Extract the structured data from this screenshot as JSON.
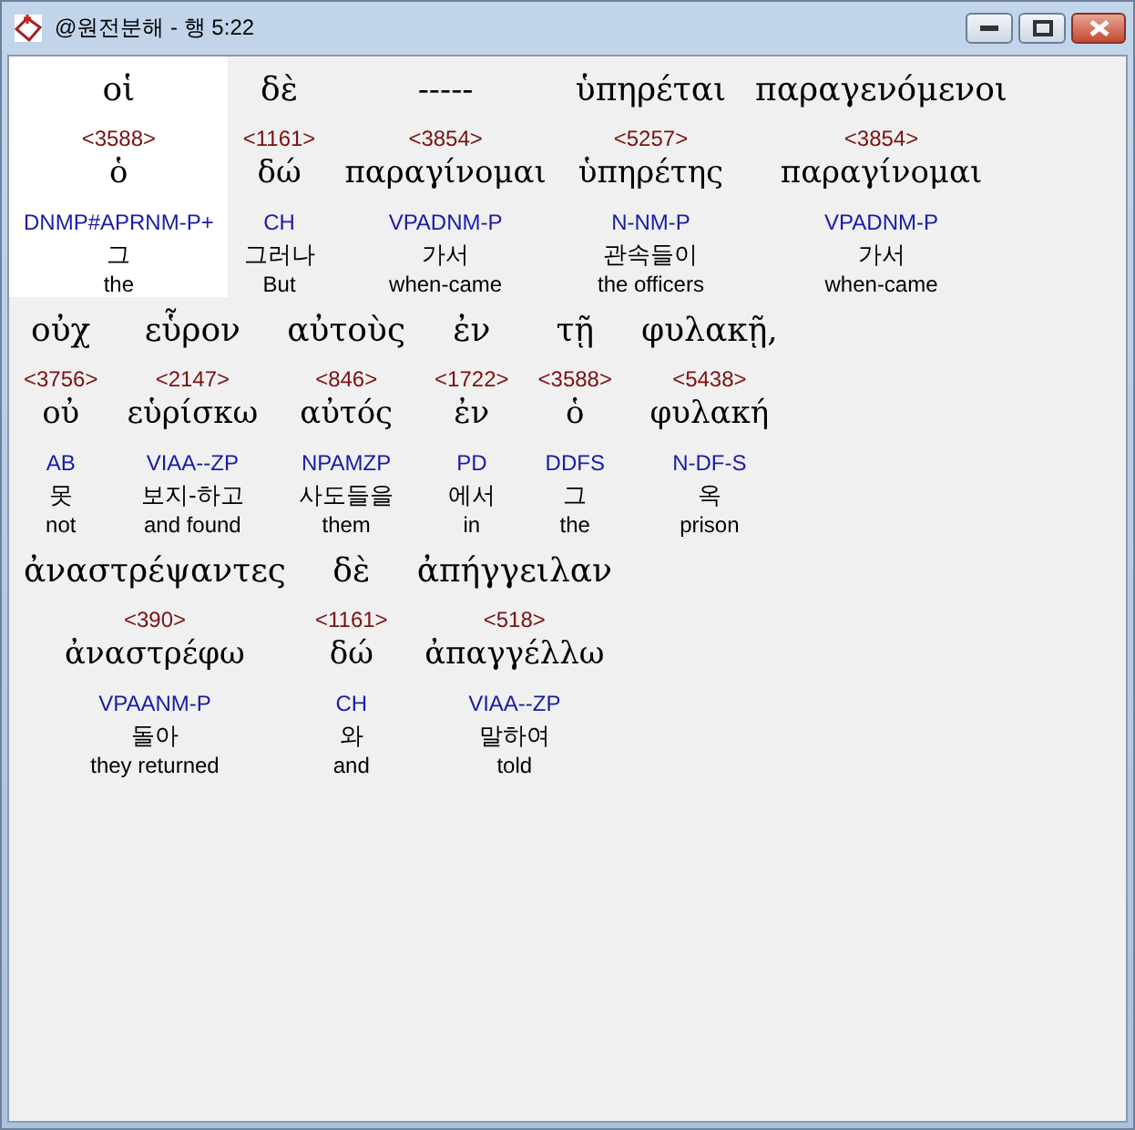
{
  "window": {
    "title": "@원전분해 - 행 5:22"
  },
  "lines": [
    {
      "words": [
        {
          "greek": "οἱ",
          "strong": "<3588>",
          "lemma": "ὁ",
          "parse": "DNMP#APRNM-P+",
          "korean": "그",
          "english": "the",
          "selected": true
        },
        {
          "greek": "δὲ",
          "strong": "<1161>",
          "lemma": "δώ",
          "parse": "CH",
          "korean": "그러나",
          "english": "But",
          "selected": false
        },
        {
          "greek": "-----",
          "strong": "<3854>",
          "lemma": "παραγίνομαι",
          "parse": "VPADNM-P",
          "korean": "가서",
          "english": "when-came",
          "selected": false
        },
        {
          "greek": "ὑπηρέται",
          "strong": "<5257>",
          "lemma": "ὑπηρέτης",
          "parse": "N-NM-P",
          "korean": "관속들이",
          "english": "the officers",
          "selected": false
        },
        {
          "greek": "παραγενόμενοι",
          "strong": "<3854>",
          "lemma": "παραγίνομαι",
          "parse": "VPADNM-P",
          "korean": "가서",
          "english": "when-came",
          "selected": false
        }
      ]
    },
    {
      "words": [
        {
          "greek": "οὐχ",
          "strong": "<3756>",
          "lemma": "οὐ",
          "parse": "AB",
          "korean": "못",
          "english": "not",
          "selected": false
        },
        {
          "greek": "εὗρον",
          "strong": "<2147>",
          "lemma": "εὑρίσκω",
          "parse": "VIAA--ZP",
          "korean": "보지-하고",
          "english": "and found",
          "selected": false
        },
        {
          "greek": "αὐτοὺς",
          "strong": "<846>",
          "lemma": "αὐτός",
          "parse": "NPAMZP",
          "korean": "사도들을",
          "english": "them",
          "selected": false
        },
        {
          "greek": "ἐν",
          "strong": "<1722>",
          "lemma": "ἐν",
          "parse": "PD",
          "korean": "에서",
          "english": "in",
          "selected": false
        },
        {
          "greek": "τῇ",
          "strong": "<3588>",
          "lemma": "ὁ",
          "parse": "DDFS",
          "korean": "그",
          "english": "the",
          "selected": false
        },
        {
          "greek": "φυλακῇ,",
          "strong": "<5438>",
          "lemma": "φυλακή",
          "parse": "N-DF-S",
          "korean": "옥",
          "english": "prison",
          "selected": false
        }
      ]
    },
    {
      "words": [
        {
          "greek": "ἀναστρέψαντες",
          "strong": "<390>",
          "lemma": "ἀναστρέφω",
          "parse": "VPAANM-P",
          "korean": "돌아",
          "english": "they returned",
          "selected": false
        },
        {
          "greek": "δὲ",
          "strong": "<1161>",
          "lemma": "δώ",
          "parse": "CH",
          "korean": "와",
          "english": "and",
          "selected": false
        },
        {
          "greek": "ἀπήγγειλαν",
          "strong": "<518>",
          "lemma": "ἀπαγγέλλω",
          "parse": "VIAA--ZP",
          "korean": "말하여",
          "english": "told",
          "selected": false
        }
      ]
    }
  ]
}
